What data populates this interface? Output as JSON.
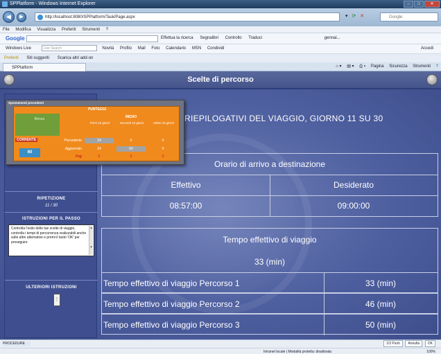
{
  "browser": {
    "title": "SPPlatform - Windows Internet Explorer",
    "url": "http://localhost:8080/SPPlatform/Task/Page.aspx",
    "search_placeholder": "Google",
    "menu": [
      "File",
      "Modifica",
      "Visualizza",
      "Preferiti",
      "Strumenti",
      "?"
    ],
    "google_bar": {
      "logo": "Google",
      "items": [
        "Effettua la ricerca",
        "Segnalibri",
        "Controllo",
        "Traduci",
        "gennai..."
      ]
    },
    "live_bar": {
      "label": "Windows Live",
      "search_placeholder": "Live Search",
      "items": [
        "Novità",
        "Profilo",
        "Mail",
        "Foto",
        "Calendario",
        "MSN",
        "Condividi"
      ],
      "right": "Accedi"
    },
    "favorites_bar": [
      "Preferiti",
      "Siti suggeriti",
      "Scarica altri add-on"
    ],
    "tab_label": "SPPlatform",
    "tools": [
      "Pagina",
      "Sicurezza",
      "Strumenti"
    ],
    "status_left": "PROCEDURE",
    "status_buttons": [
      "1/3 Punti",
      "Annulla",
      "OK"
    ],
    "status_zone": "Intranet locale | Modalità protetta: disattivata",
    "status_zoom": "100%"
  },
  "app": {
    "title": "Scelte di percorso",
    "summary_heading": "RIEPILOGATIVI DEL VIAGGIO, GIORNO 11 SU 30",
    "arrival": {
      "header": "Orario di arrivo a destinazione",
      "col_effettivo": "Effettivo",
      "col_desiderato": "Desiderato",
      "effettivo": "08:57:00",
      "desiderato": "09:00:00"
    },
    "travel": {
      "header": "Tempo effettivo di viaggio",
      "total": "33 (min)",
      "routes": [
        {
          "label": "Tempo effettivo di viaggio Percorso 1",
          "value": "33 (min)"
        },
        {
          "label": "Tempo effettivo di viaggio Percorso 2",
          "value": "46 (min)"
        },
        {
          "label": "Tempo effettivo di viaggio Percorso 3",
          "value": "50 (min)"
        }
      ]
    },
    "sidebar": {
      "ripetizione_label": "RIPETIZIONE",
      "ripetizione_value": "11 / 30",
      "istruzioni_label": "ISTRUZIONI PER IL PASSO",
      "istruzioni_text": "Controlla l'esito delle tue scelte di viaggio, controlla i tempi di percorrenza realizzabili anche sulle altre alternative e premi il tasto 'OK' per proseguire",
      "ulteriori_label": "ULTERIORI ISTRUZIONI"
    },
    "popup": {
      "title": "Spostamenti precedenti",
      "punteggi": "PUNTEGGI",
      "medio": "MEDIO",
      "col_headers": [
        "Primi 10 giorni",
        "Secondi 10 giorni",
        "Ultimi 10 giorni"
      ],
      "corrente": "CORRENTE",
      "score_big": "60",
      "green_label": "Bonus",
      "rows": [
        {
          "label": "Precedente",
          "values": [
            "24",
            "0",
            "0"
          ]
        },
        {
          "label": "Aggiornato",
          "values": [
            "24",
            "60",
            "0"
          ]
        },
        {
          "label": "Fog",
          "values": [
            "0",
            "0",
            "0"
          ]
        }
      ]
    }
  }
}
